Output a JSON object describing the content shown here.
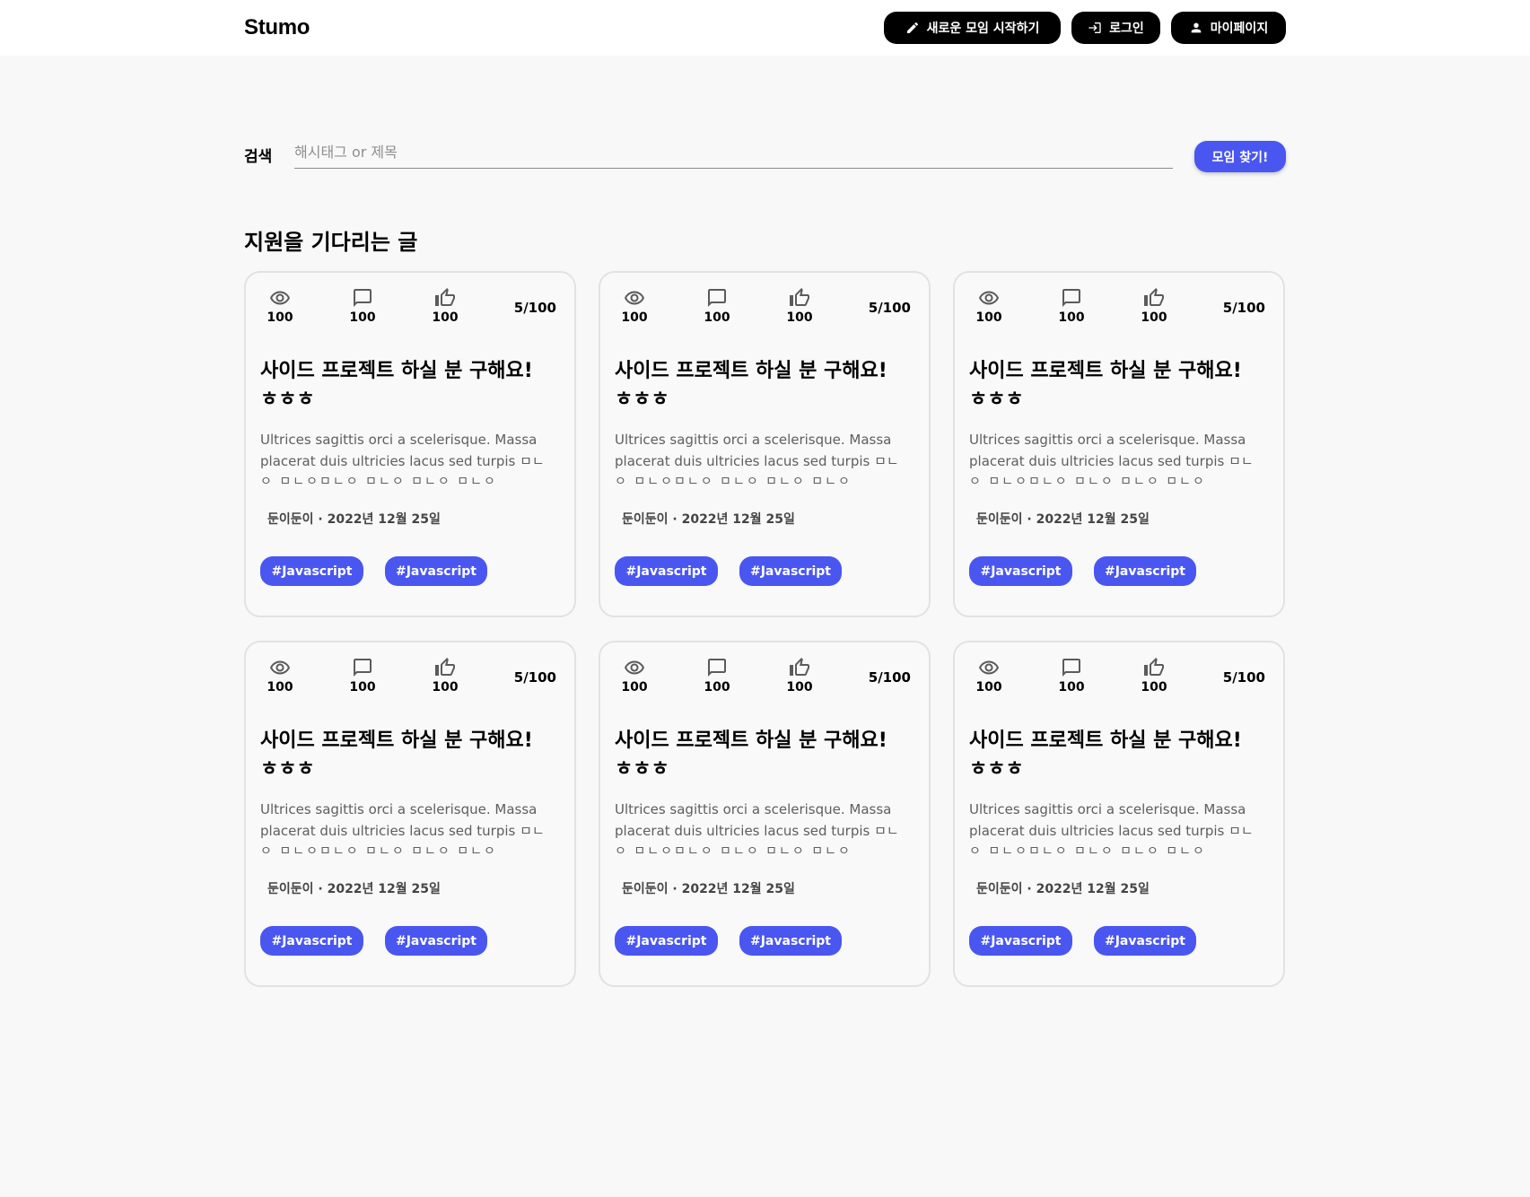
{
  "header": {
    "logo": "Stumo",
    "buttons": {
      "new_meeting": "새로운 모임 시작하기",
      "login": "로그인",
      "mypage": "마이페이지"
    }
  },
  "search": {
    "label": "검색",
    "placeholder": "해시태그 or 제목",
    "button": "모임 찾기!"
  },
  "section": {
    "title": "지원을 기다리는 글"
  },
  "colors": {
    "accent": "#4a56f0",
    "header_button_bg": "#000000"
  },
  "icons": {
    "views": "eye-icon",
    "comments": "comment-icon",
    "likes": "thumb-up-icon"
  },
  "posts": [
    {
      "views": "100",
      "comments": "100",
      "likes": "100",
      "ratio": "5/100",
      "title": "사이드 프로젝트 하실 분 구해요! ㅎㅎㅎ",
      "desc": "Ultrices sagittis orci a scelerisque. Massa placerat duis ultricies lacus sed turpis ㅁㄴ",
      "desc2": "ㅇ ㅁㄴㅇㅁㄴㅇ ㅁㄴㅇ ㅁㄴㅇ ㅁㄴㅇ",
      "meta": "둔이둔이 · 2022년 12월 25일",
      "tags": [
        "#Javascript",
        "#Javascript"
      ]
    },
    {
      "views": "100",
      "comments": "100",
      "likes": "100",
      "ratio": "5/100",
      "title": "사이드 프로젝트 하실 분 구해요! ㅎㅎㅎ",
      "desc": "Ultrices sagittis orci a scelerisque. Massa placerat duis ultricies lacus sed turpis ㅁㄴ",
      "desc2": "ㅇ ㅁㄴㅇㅁㄴㅇ ㅁㄴㅇ ㅁㄴㅇ ㅁㄴㅇ",
      "meta": "둔이둔이 · 2022년 12월 25일",
      "tags": [
        "#Javascript",
        "#Javascript"
      ]
    },
    {
      "views": "100",
      "comments": "100",
      "likes": "100",
      "ratio": "5/100",
      "title": "사이드 프로젝트 하실 분 구해요! ㅎㅎㅎ",
      "desc": "Ultrices sagittis orci a scelerisque. Massa placerat duis ultricies lacus sed turpis ㅁㄴ",
      "desc2": "ㅇ ㅁㄴㅇㅁㄴㅇ ㅁㄴㅇ ㅁㄴㅇ ㅁㄴㅇ",
      "meta": "둔이둔이 · 2022년 12월 25일",
      "tags": [
        "#Javascript",
        "#Javascript"
      ]
    },
    {
      "views": "100",
      "comments": "100",
      "likes": "100",
      "ratio": "5/100",
      "title": "사이드 프로젝트 하실 분 구해요! ㅎㅎㅎ",
      "desc": "Ultrices sagittis orci a scelerisque. Massa placerat duis ultricies lacus sed turpis ㅁㄴ",
      "desc2": "ㅇ ㅁㄴㅇㅁㄴㅇ ㅁㄴㅇ ㅁㄴㅇ ㅁㄴㅇ",
      "meta": "둔이둔이 · 2022년 12월 25일",
      "tags": [
        "#Javascript",
        "#Javascript"
      ]
    },
    {
      "views": "100",
      "comments": "100",
      "likes": "100",
      "ratio": "5/100",
      "title": "사이드 프로젝트 하실 분 구해요! ㅎㅎㅎ",
      "desc": "Ultrices sagittis orci a scelerisque. Massa placerat duis ultricies lacus sed turpis ㅁㄴ",
      "desc2": "ㅇ ㅁㄴㅇㅁㄴㅇ ㅁㄴㅇ ㅁㄴㅇ ㅁㄴㅇ",
      "meta": "둔이둔이 · 2022년 12월 25일",
      "tags": [
        "#Javascript",
        "#Javascript"
      ]
    },
    {
      "views": "100",
      "comments": "100",
      "likes": "100",
      "ratio": "5/100",
      "title": "사이드 프로젝트 하실 분 구해요! ㅎㅎㅎ",
      "desc": "Ultrices sagittis orci a scelerisque. Massa placerat duis ultricies lacus sed turpis ㅁㄴ",
      "desc2": "ㅇ ㅁㄴㅇㅁㄴㅇ ㅁㄴㅇ ㅁㄴㅇ ㅁㄴㅇ",
      "meta": "둔이둔이 · 2022년 12월 25일",
      "tags": [
        "#Javascript",
        "#Javascript"
      ]
    }
  ]
}
